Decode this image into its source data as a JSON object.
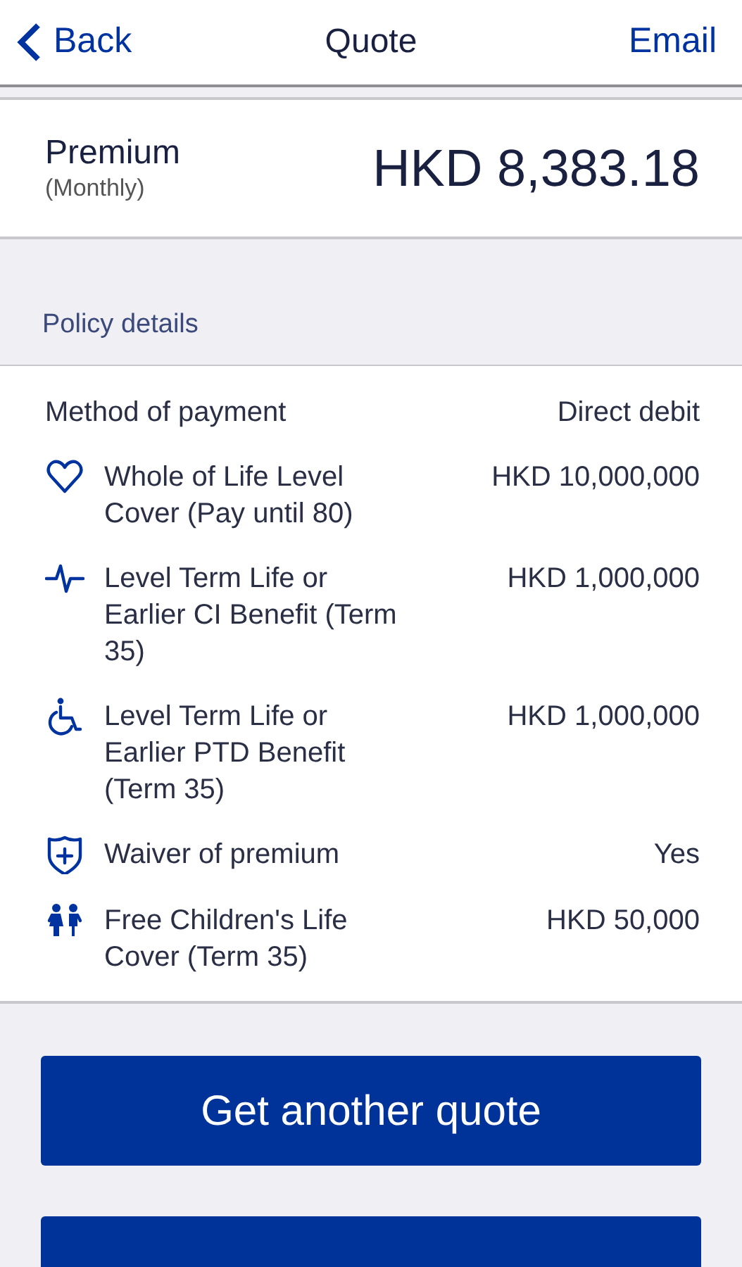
{
  "nav": {
    "back": "Back",
    "title": "Quote",
    "action": "Email"
  },
  "premium": {
    "label": "Premium",
    "period": "(Monthly)",
    "amount": "HKD 8,383.18"
  },
  "section_title": "Policy details",
  "details": [
    {
      "kind": "plain",
      "label": "Method of payment",
      "value": "Direct debit"
    },
    {
      "kind": "heart",
      "label": "Whole of Life Level Cover (Pay until 80)",
      "value": "HKD 10,000,000"
    },
    {
      "kind": "pulse",
      "label": "Level Term Life or Earlier CI Benefit (Term 35)",
      "value": "HKD 1,000,000"
    },
    {
      "kind": "wheelchair",
      "label": "Level Term Life or Earlier PTD Benefit (Term 35)",
      "value": "HKD 1,000,000"
    },
    {
      "kind": "shield",
      "label": "Waiver of premium",
      "value": "Yes"
    },
    {
      "kind": "children",
      "label": "Free Children's Life Cover (Term 35)",
      "value": "HKD 50,000"
    }
  ],
  "buttons": [
    "Get another quote"
  ]
}
